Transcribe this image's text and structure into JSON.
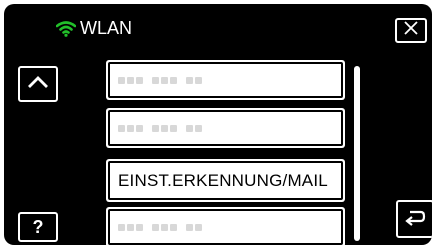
{
  "header": {
    "title": "WLAN",
    "wifi_icon": "wifi-icon",
    "wifi_color": "#22c02a"
  },
  "buttons": {
    "close_icon": "close-icon",
    "up_icon": "chevron-up-icon",
    "help_label": "?",
    "back_icon": "return-icon"
  },
  "list": {
    "items": [
      {
        "label": "",
        "placeholder": true
      },
      {
        "label": "",
        "placeholder": true
      },
      {
        "label": "EINST.ERKENNUNG/MAIL",
        "placeholder": false
      },
      {
        "label": "",
        "placeholder": true
      }
    ]
  }
}
